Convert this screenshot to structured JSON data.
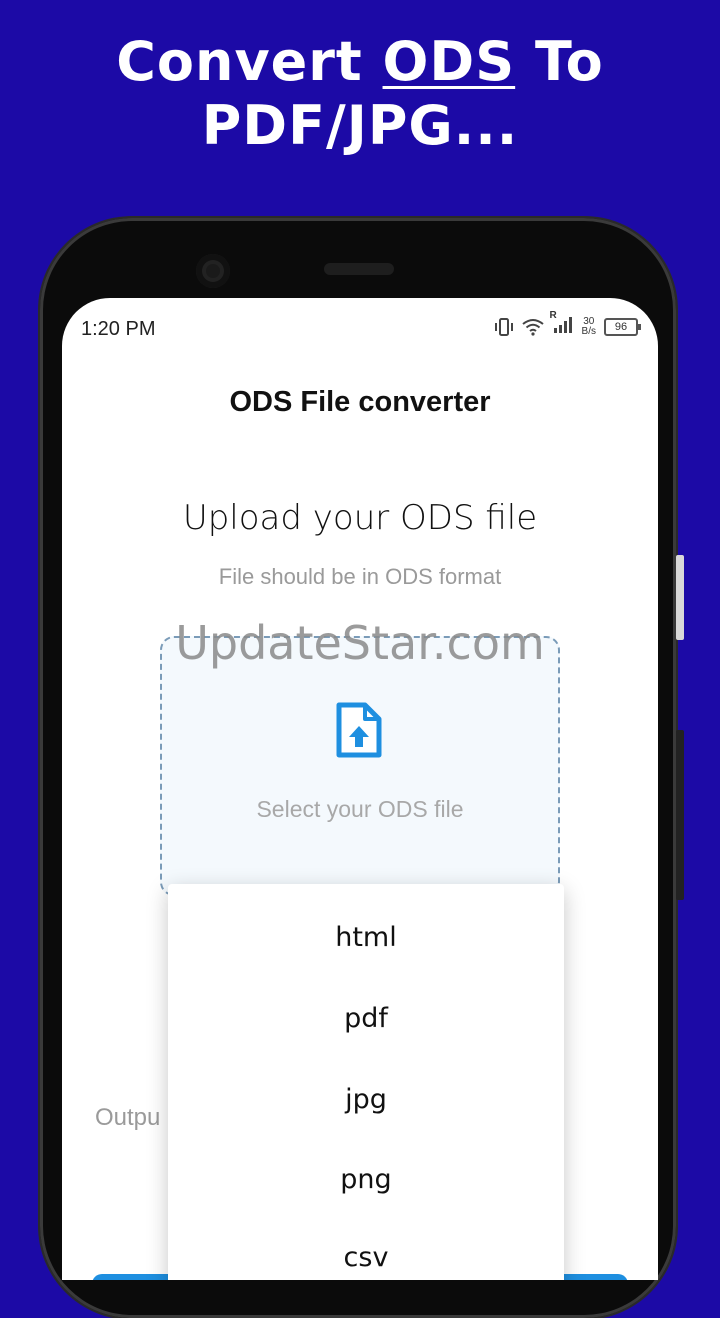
{
  "promo": {
    "line1_pre": "Convert",
    "line1_highlight": "ODS",
    "line1_post": "To",
    "line2": "PDF/JPG..."
  },
  "status_bar": {
    "time": "1:20 PM",
    "network_speed_value": "30",
    "network_speed_unit": "B/s",
    "signal_label": "R",
    "battery_level": "96"
  },
  "app": {
    "title": "ODS File converter",
    "upload_heading": "Upload your ODS file",
    "upload_hint": "File should be in ODS format",
    "dropzone_label": "Select your ODS file",
    "output_label": "Outpu"
  },
  "watermark": "UpdateStar.com",
  "dropdown": {
    "options": [
      "html",
      "pdf",
      "jpg",
      "png",
      "csv"
    ]
  },
  "colors": {
    "background": "#1c0aa6",
    "accent": "#1e8fe0"
  },
  "icons": {
    "upload": "file-upload-icon",
    "vibrate": "vibrate-icon",
    "wifi": "wifi-icon",
    "signal": "signal-icon",
    "battery": "battery-icon"
  }
}
